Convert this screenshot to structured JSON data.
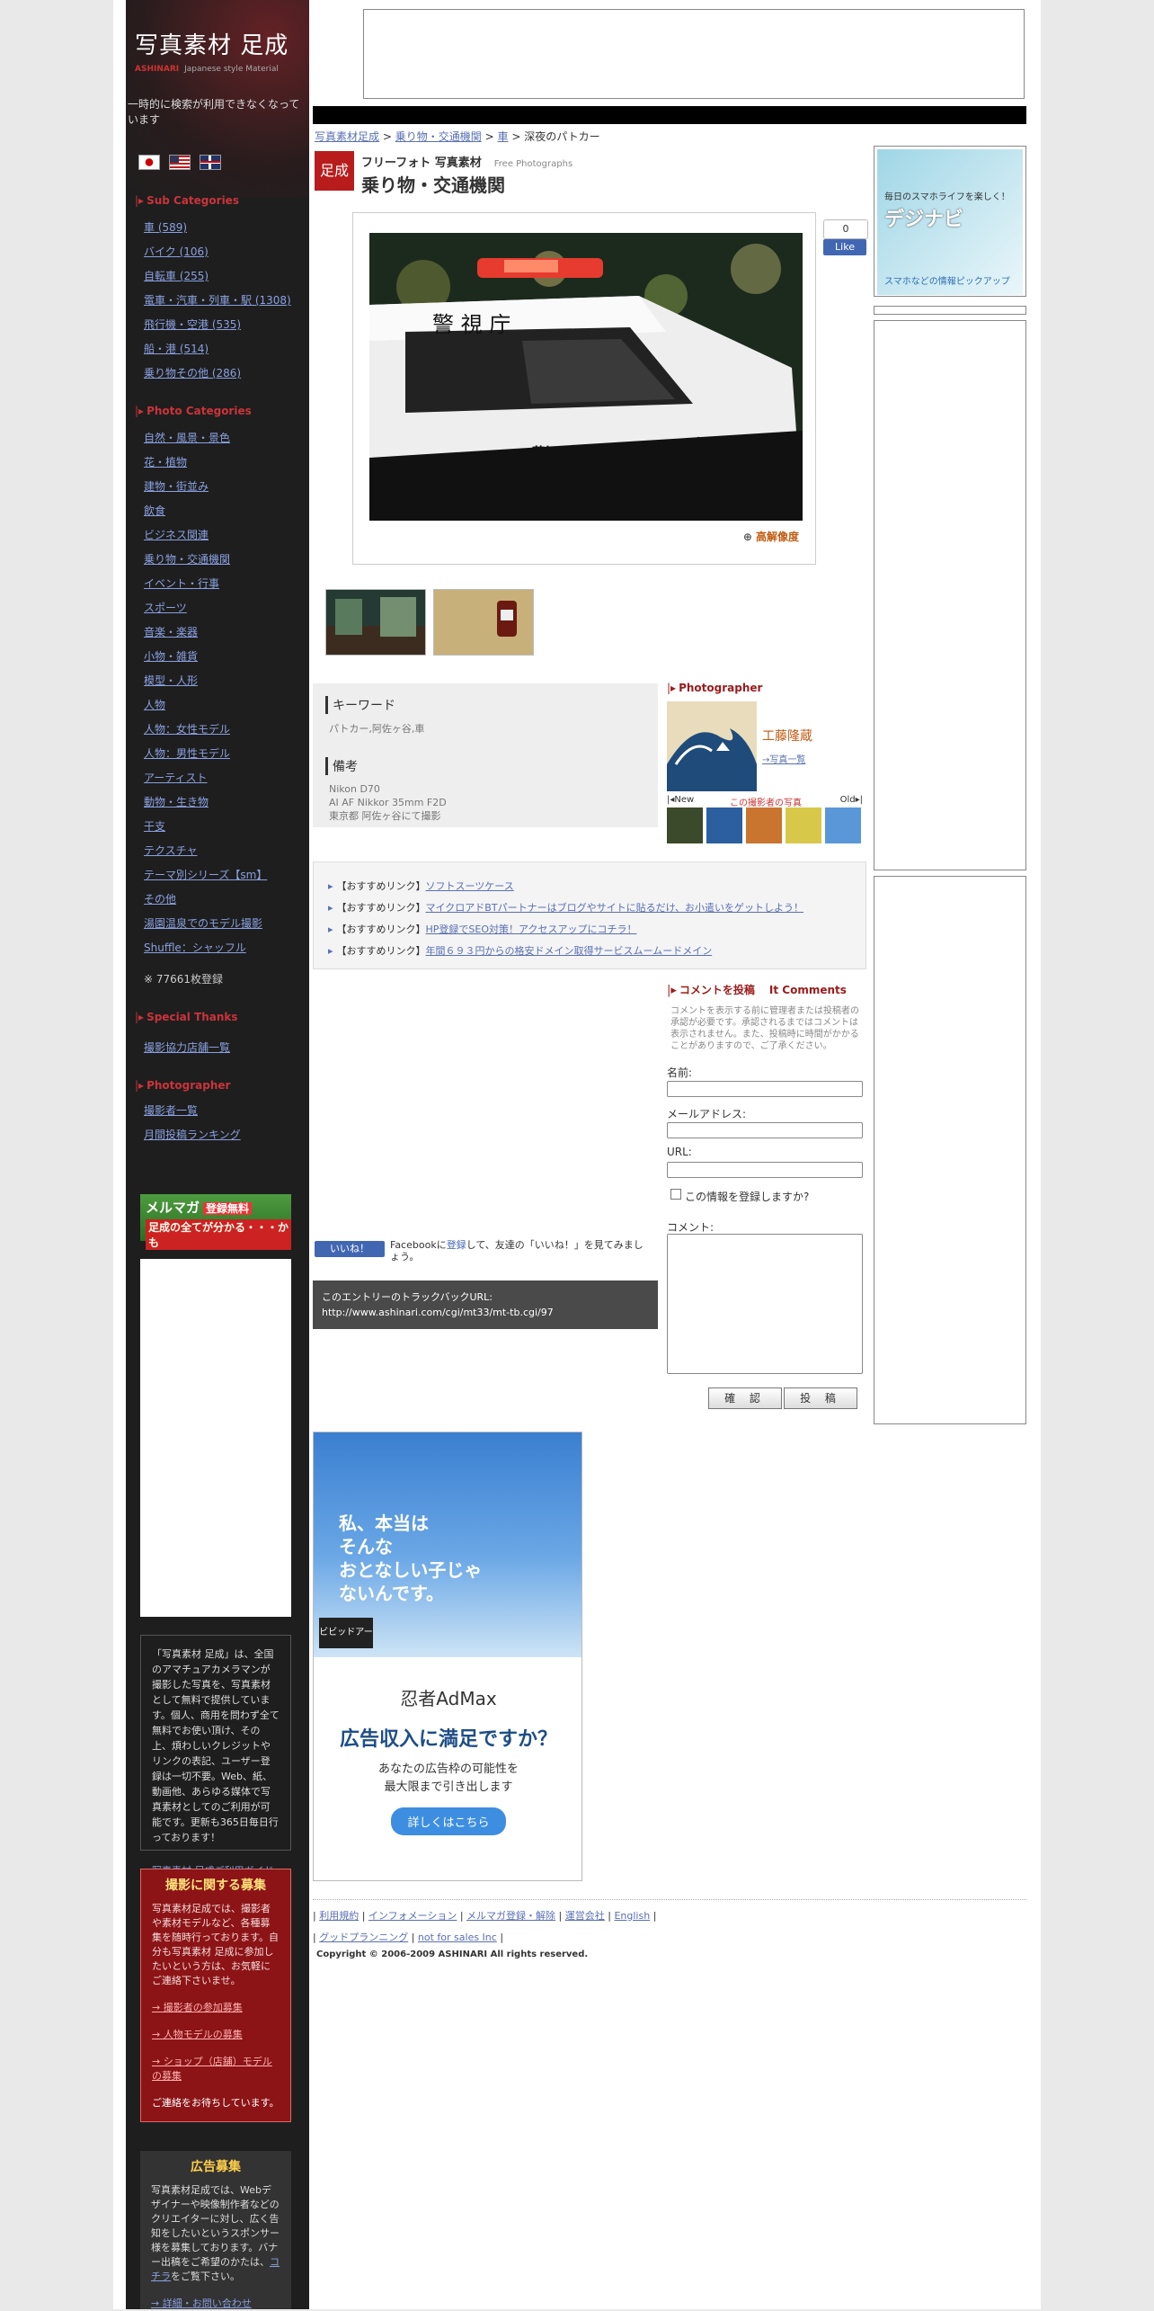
{
  "sidebar": {
    "logo_text": "写真素材 足成",
    "logo_sub_left": "ASHINARI",
    "logo_sub_right": "Japanese style Material",
    "notice": "一時的に検索が利用できなくなっています",
    "sub_categories_head": "Sub Categories",
    "sub_categories": [
      "車 (589)",
      "バイク (106)",
      "自転車 (255)",
      "電車・汽車・列車・駅 (1308)",
      "飛行機・空港 (535)",
      "船・港 (514)",
      "乗り物その他 (286)"
    ],
    "photo_categories_head": "Photo Categories",
    "photo_categories": [
      "自然・風景・景色",
      "花・植物",
      "建物・街並み",
      "飲食",
      "ビジネス関連",
      "乗り物・交通機関",
      "イベント・行事",
      "スポーツ",
      "音楽・楽器",
      "小物・雑貨",
      "模型・人形",
      "人物",
      "人物：女性モデル",
      "人物：男性モデル",
      "アーティスト",
      "動物・生き物",
      "干支",
      "テクスチャ",
      "テーマ別シリーズ【sm】",
      "その他",
      "湯園温泉でのモデル撮影",
      "Shuffle：シャッフル"
    ],
    "photo_count": "※ 77661枚登録",
    "special_thanks_head": "Special Thanks",
    "special_thanks": [
      "撮影協力店舗一覧"
    ],
    "photographer_head": "Photographer",
    "photographer_links": [
      "撮影者一覧",
      "月間投稿ランキング"
    ],
    "mailmag_l1": "メルマガ",
    "mailmag_badge": "登録無料",
    "mailmag_l2": "足成の全てが分かる・・・かも",
    "description": "「写真素材 足成」は、全国のアマチュアカメラマンが撮影した写真を、写真素材として無料で提供しています。個人、商用を問わず全て無料でお使い頂け、その上、煩わしいクレジットやリンクの表記、ユーザー登録は一切不要。Web、紙、動画他、あらゆる媒体で写真素材としてのご利用が可能です。更新も365日毎日行っております！",
    "usage_guide": "写真素材 足成ご利用ガイド",
    "recruit_title": "撮影に関する募集",
    "recruit_text": "写真素材足成では、撮影者や素材モデルなど、各種募集を随時行っております。自分も写真素材 足成に参加したいという方は、お気軽にご連絡下さいませ。",
    "recruit_links": [
      "→ 撮影者の参加募集",
      "→ 人物モデルの募集",
      "→ ショップ（店舗）モデルの募集"
    ],
    "recruit_end": "ご連絡をお待ちしています。",
    "ad_title": "広告募集",
    "ad_text": "写真素材足成では、Webデザイナーや映像制作者などのクリエイターに対し、広く告知をしたいというスポンサー様を募集しております。バナー出稿をご希望のかたは、",
    "ad_link": "コチラ",
    "ad_text2": "をご覧下さい。",
    "ad_more": "→ 詳細・お問い合わせ"
  },
  "breadcrumb": {
    "items": [
      "写真素材足成",
      "乗り物・交通機関",
      "車"
    ],
    "sep": ">",
    "current": "深夜のパトカー"
  },
  "category": {
    "logo": "足成",
    "sub": "フリーフォト 写真素材",
    "sub_en": "Free Photographs",
    "title": "乗り物・交通機関"
  },
  "photo": {
    "hires": "高解像度",
    "fb_count": "0",
    "fb_like": "Like"
  },
  "info": {
    "keyword_head": "キーワード",
    "keywords": "パトカー,阿佐ヶ谷,車",
    "note_head": "備考",
    "note_lines": [
      "Nikon D70",
      "AI AF Nikkor 35mm F2D",
      "東京都 阿佐ヶ谷にて撮影"
    ]
  },
  "photographer": {
    "head": "Photographer",
    "name": "工藤隆蔵",
    "list_link": "→写真一覧",
    "nav_new": "|◂New",
    "nav_center": "この撮影者の写真",
    "nav_old": "Old▸|"
  },
  "recommended": [
    {
      "prefix": "【おすすめリンク】",
      "text": "ソフトスーツケース"
    },
    {
      "prefix": "【おすすめリンク】",
      "text": "マイクロアドBTパートナーはブログやサイトに貼るだけ、お小遣いをゲットしよう！"
    },
    {
      "prefix": "【おすすめリンク】",
      "text": "HP登録でSEO対策！アクセスアップにコチラ！"
    },
    {
      "prefix": "【おすすめリンク】",
      "text": "年間６９３円からの格安ドメイン取得サービスムームードメイン"
    }
  ],
  "comment": {
    "head": "コメントを投稿",
    "head_en": "It Comments",
    "note": "コメントを表示する前に管理者または投稿者の承認が必要です。承認されるまではコメントは表示されません。また、投稿時に時間がかかることがありますので、ご了承ください。",
    "name_label": "名前:",
    "email_label": "メールアドレス:",
    "url_label": "URL:",
    "remember_label": "この情報を登録しますか?",
    "comment_label": "コメント:",
    "confirm_btn": "確 認",
    "post_btn": "投 稿"
  },
  "facebook": {
    "like_btn": "いいね！",
    "text_pre": "Facebookに",
    "text_link": "登録",
    "text_post": "して、友達の「いいね！」を見てみましょう。"
  },
  "trackback": {
    "label": "このエントリーのトラックバックURL:",
    "url": "http://www.ashinari.com/cgi/mt33/mt-tb.cgi/97"
  },
  "ad_main": {
    "text": "私、本当は\nそんな\nおとなしい子じゃ\nないんです。",
    "vivid": "ビビッドアーミー",
    "brand": "忍者AdMax",
    "question": "広告収入に満足ですか？",
    "sub1": "あなたの広告枠の可能性を",
    "sub2": "最大限まで引き出します",
    "button": "詳しくはこちら"
  },
  "ad_small": {
    "t1": "毎日のスマホライフを楽しく！",
    "t2": "デジナビ",
    "t3": "スマホなどの情報ピックアップ"
  },
  "footer": {
    "row1": [
      "利用規約",
      "インフォメーション",
      "メルマガ登録・解除",
      "運営会社",
      "English"
    ],
    "row2": [
      "グッドプランニング",
      "not for sales Inc"
    ],
    "copyright": "Copyright © 2006-2009 ASHINARI All rights reserved."
  }
}
